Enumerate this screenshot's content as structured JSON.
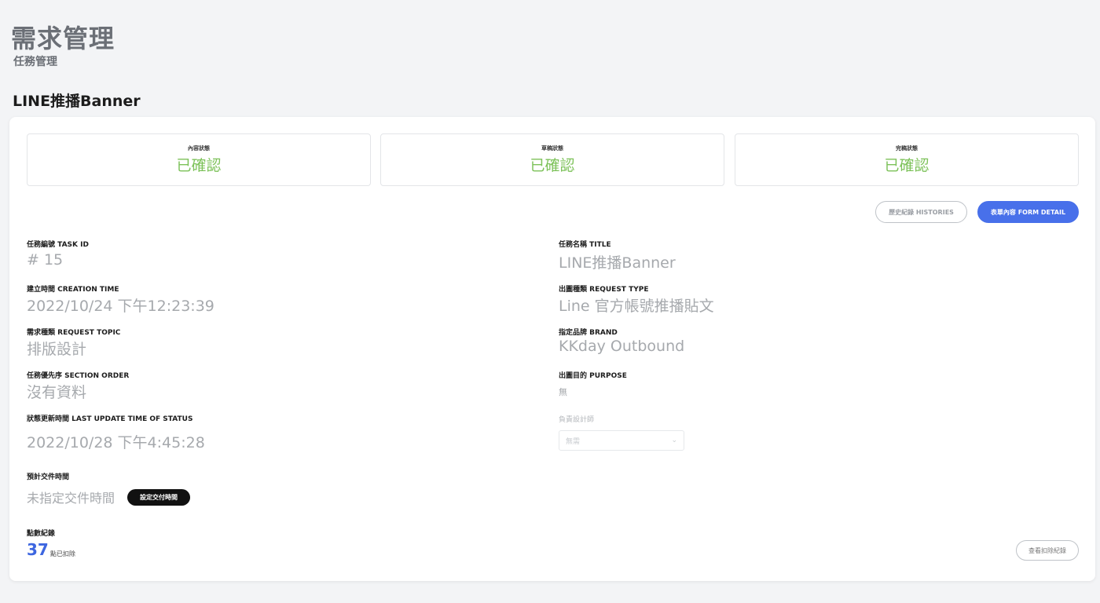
{
  "header": {
    "title": "需求管理",
    "subtitle": "任務管理",
    "section_title": "LINE推播Banner"
  },
  "statuses": [
    {
      "label": "內容狀態",
      "value": "已確認"
    },
    {
      "label": "草稿狀態",
      "value": "已確認"
    },
    {
      "label": "完稿狀態",
      "value": "已確認"
    }
  ],
  "colors": {
    "status_confirmed": "#7dc25a",
    "primary": "#4870ea",
    "points": "#3d66e0"
  },
  "actions": {
    "histories_label": "歷史紀錄 HISTORIES",
    "form_detail_label": "表單內容 FORM DETAIL",
    "set_delivery_label": "設定交付時間",
    "view_deduction_label": "查看扣除紀錄"
  },
  "fields": {
    "task_id": {
      "label": "任務編號 TASK ID",
      "value": "# 15"
    },
    "title": {
      "label": "任務名稱 TITLE",
      "value": "LINE推播Banner"
    },
    "creation_time": {
      "label": "建立時間 CREATION TIME",
      "value": "2022/10/24 下午12:23:39"
    },
    "request_type": {
      "label": "出圖種類 REQUEST TYPE",
      "value": "Line 官方帳號推播貼文"
    },
    "request_topic": {
      "label": "需求種類 REQUEST TOPIC",
      "value": "排版設計"
    },
    "brand": {
      "label": "指定品牌 BRAND",
      "value": "KKday Outbound"
    },
    "section_order": {
      "label": "任務優先序 SECTION ORDER",
      "value": "沒有資料"
    },
    "purpose": {
      "label": "出圖目的 PURPOSE",
      "value": "無"
    },
    "last_update": {
      "label": "狀態更新時間 LAST UPDATE TIME OF STATUS",
      "value": "2022/10/28 下午4:45:28"
    },
    "designer": {
      "label": "負責設計師",
      "value": "無需"
    },
    "expected_delivery": {
      "label": "預計交件時間",
      "value": "未指定交件時間"
    }
  },
  "points": {
    "label": "點數紀錄",
    "value": "37",
    "unit": "點已扣除"
  }
}
